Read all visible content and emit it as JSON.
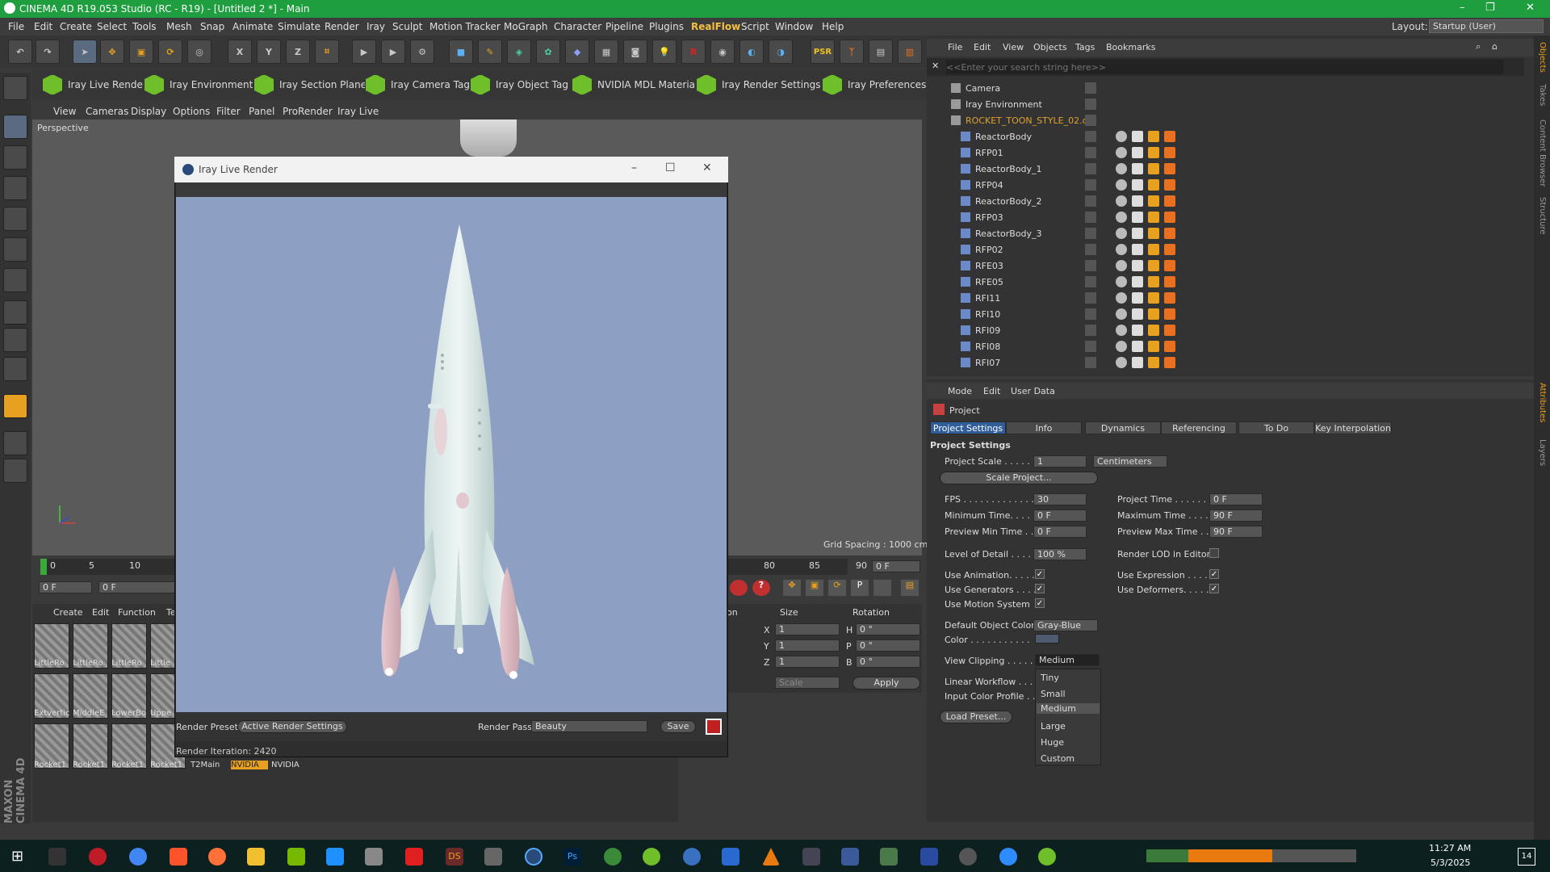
{
  "window": {
    "title": "CINEMA 4D R19.053 Studio (RC - R19) - [Untitled 2 *] - Main",
    "controls": [
      "–",
      "❐",
      "✕"
    ]
  },
  "menubar": {
    "items": [
      "File",
      "Edit",
      "Create",
      "Select",
      "Tools",
      "Mesh",
      "Snap",
      "Animate",
      "Simulate",
      "Render",
      "Iray",
      "Sculpt",
      "Motion Tracker",
      "MoGraph",
      "Character",
      "Pipeline",
      "Plugins",
      "RealFlow",
      "Script",
      "Window",
      "Help"
    ],
    "layout_label": "Layout:",
    "layout_value": "Startup (User)"
  },
  "iray_toolbar": {
    "items": [
      "Iray Live Render",
      "Iray Environment",
      "Iray Section Plane",
      "Iray Camera Tag",
      "Iray Object Tag",
      "NVIDIA MDL Material",
      "Iray Render Settings",
      "Iray Preferences"
    ]
  },
  "viewport": {
    "menu": [
      "View",
      "Cameras",
      "Display",
      "Options",
      "Filter",
      "Panel",
      "ProRender",
      "Iray Live"
    ],
    "label": "Perspective",
    "grid_spacing": "Grid Spacing : 1000 cm"
  },
  "timeline": {
    "ticks_left": [
      "0",
      "5",
      "10"
    ],
    "ticks_right": [
      "80",
      "85",
      "90"
    ],
    "current_frame": "0 F",
    "start_field": "0 F",
    "range_field": "0 F",
    "end_field": "0 F"
  },
  "materials": {
    "menu": [
      "Create",
      "Edit",
      "Function",
      "Te"
    ],
    "rows": [
      [
        "LittleRo",
        "LittleRo",
        "LittleRo",
        "Little"
      ],
      [
        "Extvertic",
        "MiddleE",
        "LowerBo",
        "Uppe"
      ],
      [
        "Rocket1",
        "Rocket1",
        "Rocket1",
        "Rocket1",
        "T2Main",
        "NVIDIA",
        "NVIDIA"
      ]
    ]
  },
  "coords": {
    "header_pos": "on",
    "header_size": "Size",
    "header_rot": "Rotation",
    "rows": [
      {
        "axis": "X",
        "size": "1",
        "rot_axis": "H",
        "rot": "0 °"
      },
      {
        "axis": "Y",
        "size": "1",
        "rot_axis": "P",
        "rot": "0 °"
      },
      {
        "axis": "Z",
        "size": "1",
        "rot_axis": "B",
        "rot": "0 °"
      }
    ],
    "scale_dropdown": "Scale",
    "apply": "Apply"
  },
  "iray_window": {
    "title": "Iray Live Render",
    "render_preset_label": "Render Preset",
    "render_preset_value": "Active Render Settings",
    "render_pass_label": "Render Pass",
    "render_pass_value": "Beauty",
    "save": "Save",
    "iteration": "Render Iteration: 2420"
  },
  "object_manager": {
    "menu": [
      "File",
      "Edit",
      "View",
      "Objects",
      "Tags",
      "Bookmarks"
    ],
    "search_placeholder": "<<Enter your search string here>>",
    "objects": [
      {
        "name": "Camera",
        "level": 0
      },
      {
        "name": "Iray Environment",
        "level": 0
      },
      {
        "name": "ROCKET_TOON_STYLE_02.obj",
        "level": 0,
        "highlight": true
      },
      {
        "name": "ReactorBody",
        "level": 1
      },
      {
        "name": "RFP01",
        "level": 1
      },
      {
        "name": "ReactorBody_1",
        "level": 1
      },
      {
        "name": "RFP04",
        "level": 1
      },
      {
        "name": "ReactorBody_2",
        "level": 1
      },
      {
        "name": "RFP03",
        "level": 1
      },
      {
        "name": "ReactorBody_3",
        "level": 1
      },
      {
        "name": "RFP02",
        "level": 1
      },
      {
        "name": "RFE03",
        "level": 1
      },
      {
        "name": "RFE05",
        "level": 1
      },
      {
        "name": "RFI11",
        "level": 1
      },
      {
        "name": "RFI10",
        "level": 1
      },
      {
        "name": "RFI09",
        "level": 1
      },
      {
        "name": "RFI08",
        "level": 1
      },
      {
        "name": "RFI07",
        "level": 1
      }
    ]
  },
  "attributes": {
    "menu": [
      "Mode",
      "Edit",
      "User Data"
    ],
    "object_label": "Project",
    "tabs": [
      "Project Settings",
      "Info",
      "Dynamics",
      "Referencing",
      "To Do",
      "Key Interpolation"
    ],
    "section": "Project Settings",
    "project_scale_label": "Project Scale . . . . . .",
    "project_scale_value": "1",
    "project_scale_unit": "Centimeters",
    "scale_project_btn": "Scale Project...",
    "fps_label": "FPS . . . . . . . . . . . . .",
    "fps_value": "30",
    "project_time_label": "Project Time . . . . . . . .",
    "project_time_value": "0 F",
    "min_time_label": "Minimum Time. . . . . .",
    "min_time_value": "0 F",
    "max_time_label": "Maximum Time . . . . .",
    "max_time_value": "90 F",
    "prev_min_label": "Preview Min Time . .",
    "prev_min_value": "0 F",
    "prev_max_label": "Preview Max Time . .",
    "prev_max_value": "90 F",
    "lod_label": "Level of Detail . . . . .",
    "lod_value": "100 %",
    "render_lod_label": "Render LOD in Editor",
    "use_anim_label": "Use Animation. . . . .",
    "use_expr_label": "Use Expression . . . . .",
    "use_gen_label": "Use Generators . . . .",
    "use_def_label": "Use Deformers. . . . . .",
    "use_motion_label": "Use Motion System",
    "def_color_label": "Default Object Color",
    "def_color_value": "Gray-Blue",
    "color_label": "Color . . . . . . . . . . .",
    "view_clip_label": "View Clipping . . . . .",
    "view_clip_value": "Medium",
    "linear_label": "Linear Workflow . . .",
    "input_color_label": "Input Color Profile . .",
    "load_preset": "Load Preset...",
    "clip_options": [
      "Tiny",
      "Small",
      "Medium",
      "Large",
      "Huge",
      "Custom"
    ],
    "clip_selected": "Medium"
  },
  "right_strip": [
    "Objects",
    "Takes",
    "Content Browser",
    "Structure",
    "Attributes",
    "Layers"
  ],
  "left_brand": "MAXON CINEMA 4D",
  "taskbar": {
    "time": "11:27 AM",
    "date": "5/3/2025",
    "notif": "14"
  },
  "colors": {
    "title_green": "#1e9e3e",
    "selected_tab": "#2f5e9a",
    "highlight_obj": "#e0a030",
    "render_bg": "#8e9fc4"
  }
}
